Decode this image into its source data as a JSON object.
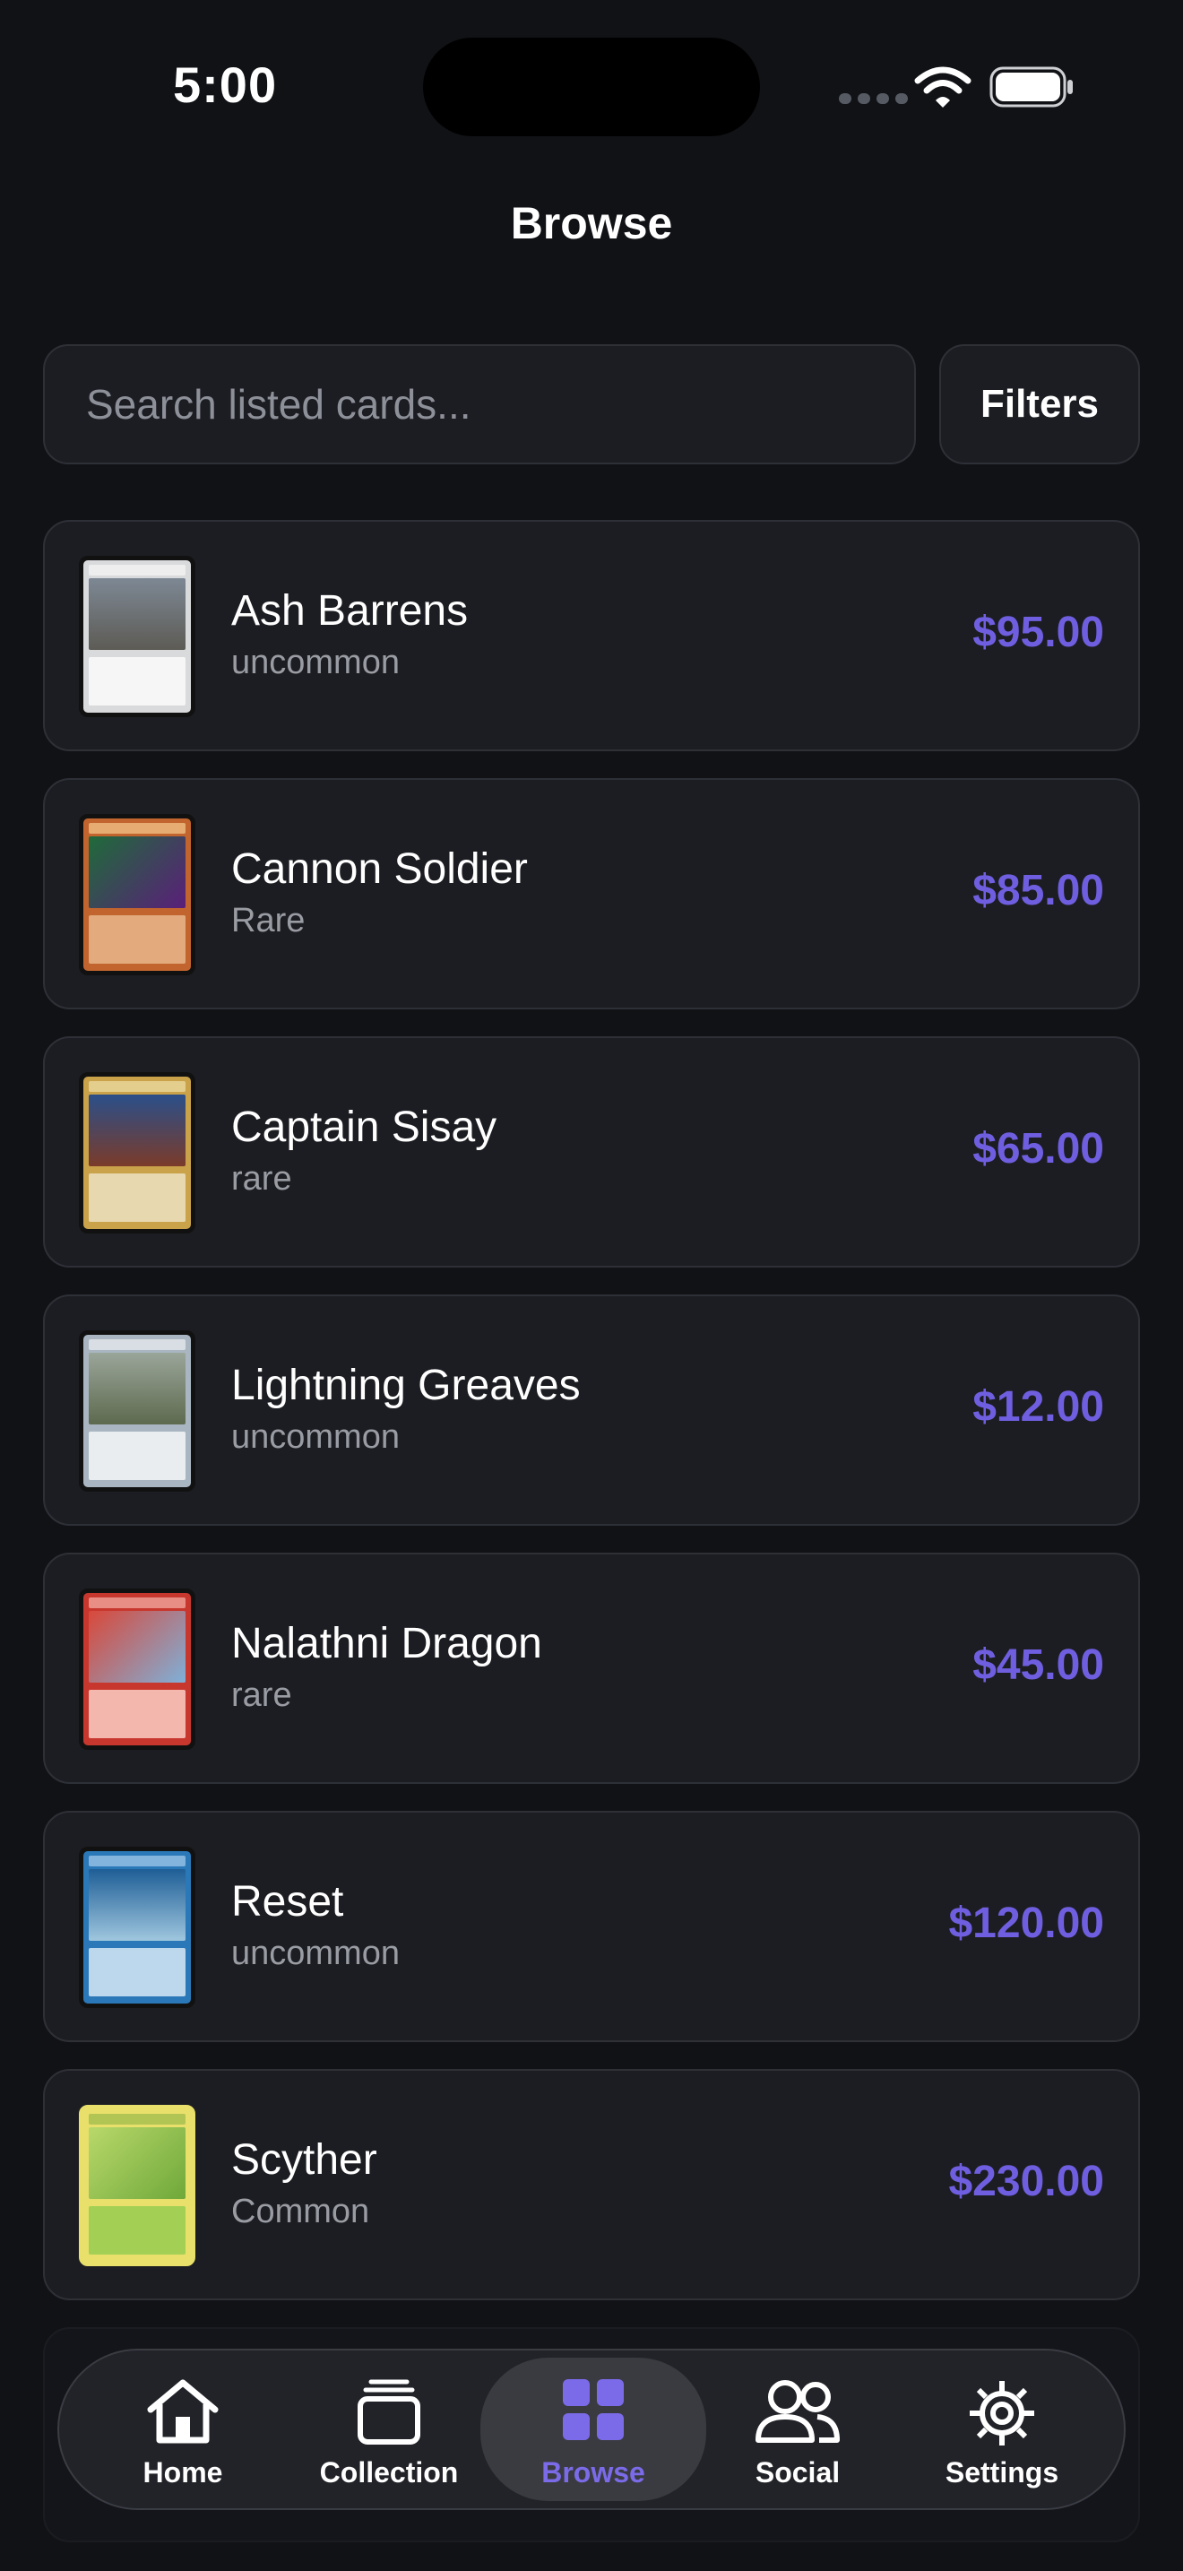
{
  "status": {
    "time": "5:00"
  },
  "header": {
    "title": "Browse"
  },
  "search": {
    "placeholder": "Search listed cards..."
  },
  "toolbar": {
    "filters_label": "Filters"
  },
  "colors": {
    "background": "#111216",
    "card": "#1c1d22",
    "accent": "#6f5fe0",
    "muted": "#9a9ca4"
  },
  "listings": [
    {
      "name": "Ash Barrens",
      "rarity": "uncommon",
      "price": "$95.00",
      "thumb": "gray-land-card"
    },
    {
      "name": "Cannon Soldier",
      "rarity": "Rare",
      "price": "$85.00",
      "thumb": "orange-monster-card"
    },
    {
      "name": "Captain Sisay",
      "rarity": "rare",
      "price": "$65.00",
      "thumb": "gold-legend-card"
    },
    {
      "name": "Lightning Greaves",
      "rarity": "uncommon",
      "price": "$12.00",
      "thumb": "silver-artifact-card"
    },
    {
      "name": "Nalathni Dragon",
      "rarity": "rare",
      "price": "$45.00",
      "thumb": "red-dragon-card"
    },
    {
      "name": "Reset",
      "rarity": "uncommon",
      "price": "$120.00",
      "thumb": "blue-instant-card"
    },
    {
      "name": "Scyther",
      "rarity": "Common",
      "price": "$230.00",
      "thumb": "green-pokemon-card"
    }
  ],
  "tabs": [
    {
      "label": "Home",
      "icon": "home-icon"
    },
    {
      "label": "Collection",
      "icon": "collection-icon"
    },
    {
      "label": "Browse",
      "icon": "browse-grid-icon",
      "active": true
    },
    {
      "label": "Social",
      "icon": "social-icon"
    },
    {
      "label": "Settings",
      "icon": "gear-icon"
    }
  ]
}
